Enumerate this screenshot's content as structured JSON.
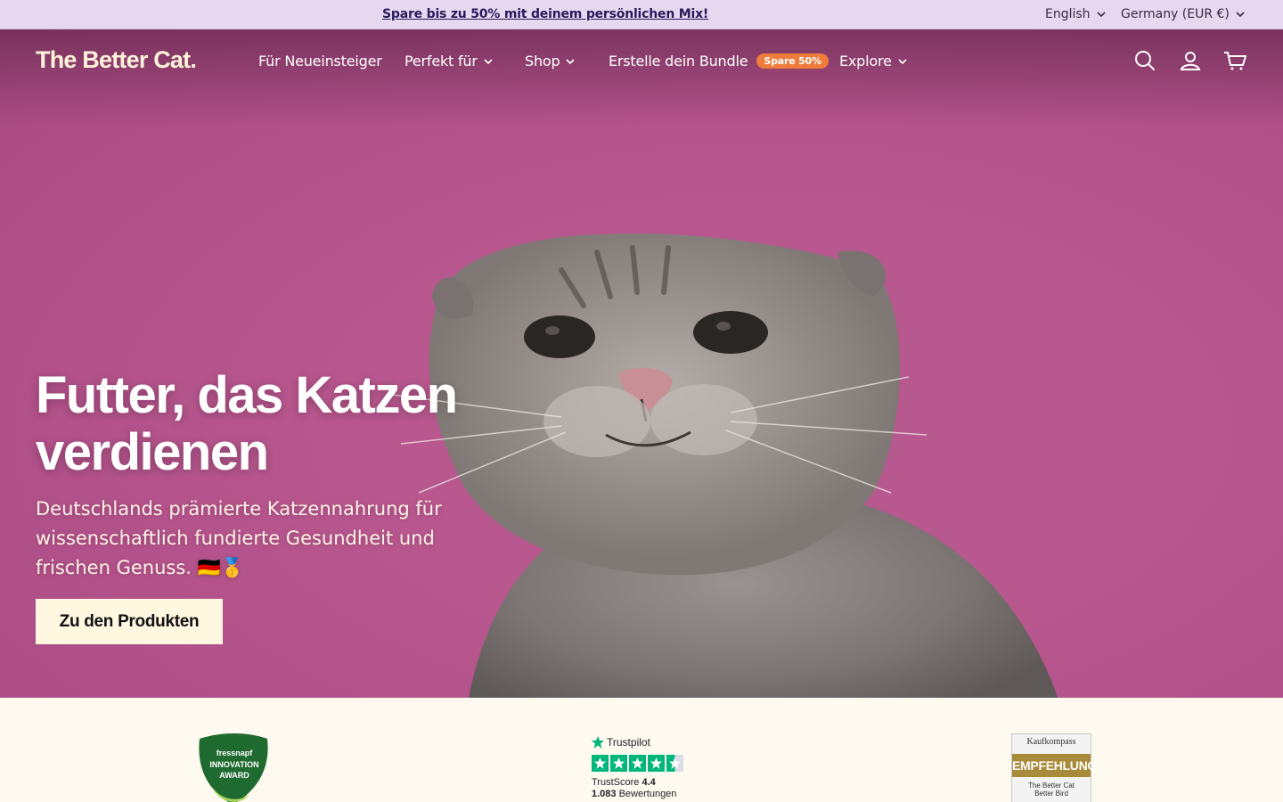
{
  "announcement": {
    "text": "Spare bis zu 50% mit deinem persönlichen Mix!",
    "language": "English",
    "country": "Germany (EUR €)"
  },
  "header": {
    "logo": "The Better Cat.",
    "nav": [
      {
        "label": "Für Neueinsteiger",
        "dropdown": false
      },
      {
        "label": "Perfekt für",
        "dropdown": true
      },
      {
        "label": "Shop",
        "dropdown": true
      },
      {
        "label": "Erstelle dein Bundle",
        "badge": "Spare 50%",
        "dropdown": false
      },
      {
        "label": "Explore",
        "dropdown": true
      }
    ],
    "icons": [
      "search-icon",
      "account-icon",
      "cart-icon"
    ]
  },
  "hero": {
    "headline": "Futter, das Katzen verdienen",
    "subtext": "Deutschlands prämierte Katzennahrung für wissenschaftlich fundierte Gesundheit und frischen Genuss. 🇩🇪🥇",
    "cta": "Zu den Produkten",
    "background_color": "#b8578e"
  },
  "trust": {
    "award": {
      "line1": "fressnapf",
      "line2": "INNOVATION",
      "line3": "AWARD"
    },
    "trustpilot": {
      "brand": "Trustpilot",
      "score_label": "TrustScore",
      "score": "4.4",
      "count": "1.083",
      "count_label": "Bewertungen",
      "rating": 4.4
    },
    "kaufkompass": {
      "brand": "Kaufkompass",
      "label": "EMPFEHLUNG",
      "product_line1": "The Better Cat",
      "product_line2": "Better Bird"
    }
  },
  "colors": {
    "accent": "#ef7c3a",
    "announce_bg": "#e6d8ee",
    "cta_bg": "#fff7e0",
    "trustpilot_green": "#00b67a"
  }
}
